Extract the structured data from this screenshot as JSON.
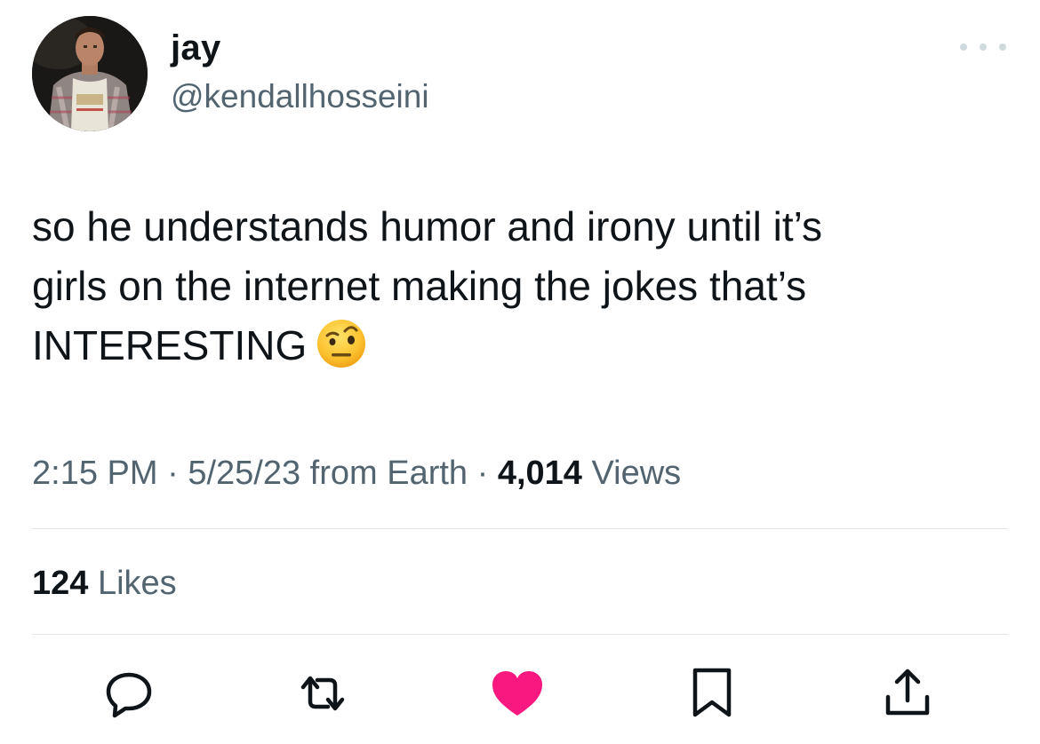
{
  "author": {
    "display_name": "jay",
    "handle": "@kendallhosseini"
  },
  "tweet": {
    "lines": [
      "so he understands humor and irony until it’s",
      "girls on the internet making the jokes that’s",
      "INTERESTING"
    ],
    "emoji": "face-with-raised-eyebrow"
  },
  "meta": {
    "time": "2:15 PM",
    "sep1": " · ",
    "date": "5/25/23",
    "source": " from Earth",
    "sep2": " · ",
    "views_count": "4,014",
    "views_label": " Views"
  },
  "engagement": {
    "likes_count": "124",
    "likes_label": " Likes"
  },
  "actions": [
    "reply-icon",
    "retweet-icon",
    "like-icon",
    "bookmark-icon",
    "share-icon"
  ],
  "colors": {
    "text": "#0f1419",
    "secondary": "#536471",
    "like": "#f91880",
    "divider": "#e1e6ea"
  }
}
